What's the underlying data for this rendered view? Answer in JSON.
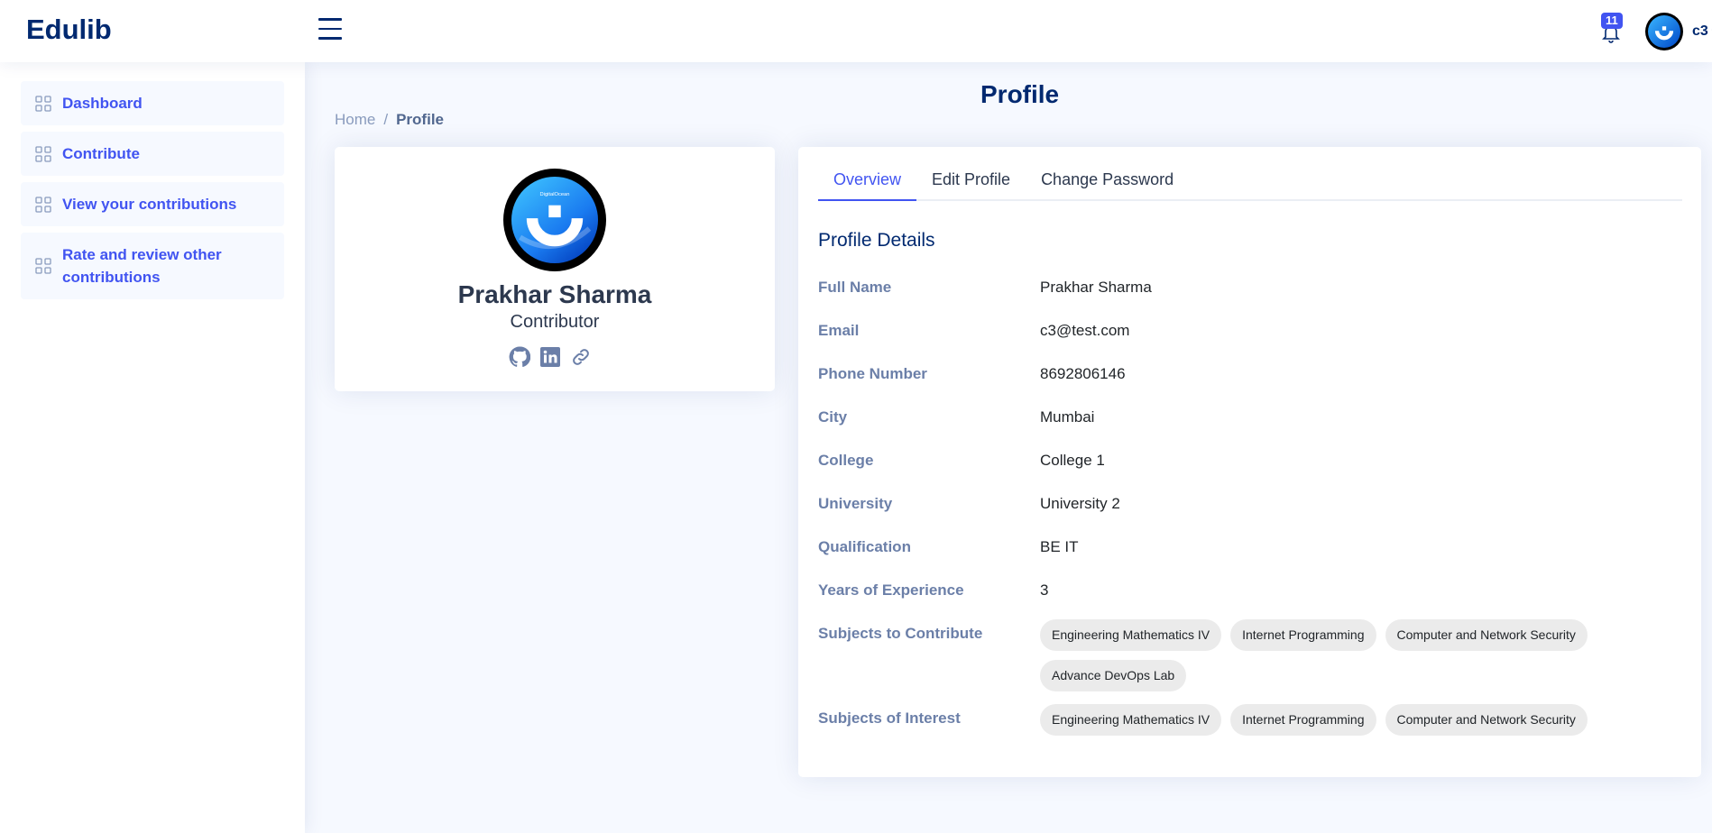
{
  "header": {
    "logo": "Edulib",
    "notification_count": "11",
    "user_name": "c3"
  },
  "sidebar": {
    "items": [
      {
        "label": "Dashboard"
      },
      {
        "label": "Contribute"
      },
      {
        "label": "View your contributions"
      },
      {
        "label": "Rate and review other contributions"
      }
    ]
  },
  "page": {
    "title": "Profile",
    "breadcrumb": {
      "home": "Home",
      "separator": "/",
      "current": "Profile"
    }
  },
  "profile_card": {
    "name": "Prakhar Sharma",
    "role": "Contributor",
    "avatar_text": "DigitalOcean",
    "social_icons": [
      "github-icon",
      "linkedin-icon",
      "link-icon"
    ]
  },
  "tabs": [
    {
      "label": "Overview",
      "active": true
    },
    {
      "label": "Edit Profile",
      "active": false
    },
    {
      "label": "Change Password",
      "active": false
    }
  ],
  "details": {
    "title": "Profile Details",
    "full_name": {
      "label": "Full Name",
      "value": "Prakhar Sharma"
    },
    "email": {
      "label": "Email",
      "value": "c3@test.com"
    },
    "phone": {
      "label": "Phone Number",
      "value": "8692806146"
    },
    "city": {
      "label": "City",
      "value": "Mumbai"
    },
    "college": {
      "label": "College",
      "value": "College 1"
    },
    "university": {
      "label": "University",
      "value": "University 2"
    },
    "qualification": {
      "label": "Qualification",
      "value": "BE IT"
    },
    "experience": {
      "label": "Years of Experience",
      "value": "3"
    },
    "subjects_contribute": {
      "label": "Subjects to Contribute",
      "values": [
        "Engineering Mathematics IV",
        "Internet Programming",
        "Computer and Network Security",
        "Advance DevOps Lab"
      ]
    },
    "subjects_interest": {
      "label": "Subjects of Interest",
      "values": [
        "Engineering Mathematics IV",
        "Internet Programming",
        "Computer and Network Security"
      ]
    }
  },
  "colors": {
    "primary": "#4154f1",
    "navy": "#012970",
    "background": "#f6f9ff",
    "label": "#6b7fa8",
    "chip": "#ebebeb"
  }
}
